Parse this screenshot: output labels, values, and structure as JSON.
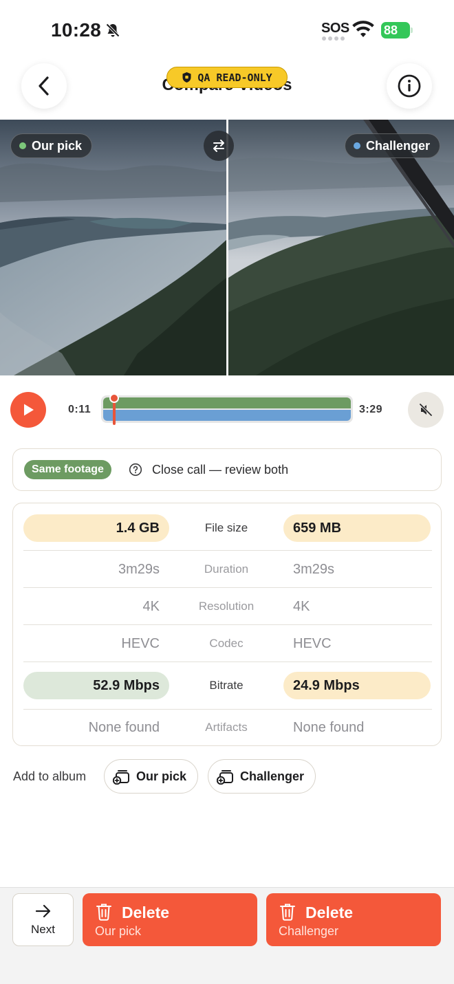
{
  "status_bar": {
    "time": "10:28",
    "bell_icon": "bell-slash-icon",
    "sos": "SOS",
    "wifi_icon": "wifi-icon",
    "battery": "88"
  },
  "header": {
    "title": "Compare Videos",
    "back_icon": "chevron-left-icon",
    "info_icon": "info-circle-icon",
    "badge": "QA READ-ONLY",
    "badge_icon": "shield-icon"
  },
  "video": {
    "left_label": "Our pick",
    "right_label": "Challenger",
    "swap_icon": "swap-arrows-icon",
    "left_dot_color": "#7cc77a",
    "right_dot_color": "#6aa7e0"
  },
  "playback": {
    "play_icon": "play-icon",
    "current_time": "0:11",
    "total_time": "3:29",
    "progress_fraction": 0.053,
    "mute_icon": "speaker-slash-icon",
    "track_top_color": "#6d9b62",
    "track_bottom_color": "#6a9fd4"
  },
  "verdict": {
    "badge": "Same footage",
    "text": "Close call — review both",
    "icon": "question-circle-icon"
  },
  "stats": [
    {
      "label": "File size",
      "left": "1.4 GB",
      "right": "659 MB",
      "highlight": true,
      "left_bg": "amber",
      "right_bg": "amber"
    },
    {
      "label": "Duration",
      "left": "3m29s",
      "right": "3m29s",
      "highlight": false,
      "left_bg": "",
      "right_bg": ""
    },
    {
      "label": "Resolution",
      "left": "4K",
      "right": "4K",
      "highlight": false,
      "left_bg": "",
      "right_bg": ""
    },
    {
      "label": "Codec",
      "left": "HEVC",
      "right": "HEVC",
      "highlight": false,
      "left_bg": "",
      "right_bg": ""
    },
    {
      "label": "Bitrate",
      "left": "52.9 Mbps",
      "right": "24.9 Mbps",
      "highlight": true,
      "left_bg": "green",
      "right_bg": "amber"
    },
    {
      "label": "Artifacts",
      "left": "None found",
      "right": "None found",
      "highlight": false,
      "left_bg": "",
      "right_bg": ""
    }
  ],
  "album": {
    "label": "Add to album",
    "our_pick": "Our pick",
    "challenger": "Challenger",
    "icon": "album-add-icon"
  },
  "bottom": {
    "next": "Next",
    "next_icon": "arrow-right-icon",
    "delete_title": "Delete",
    "delete_our_pick": "Our pick",
    "delete_challenger": "Challenger",
    "trash_icon": "trash-icon",
    "accent": "#f4583a"
  }
}
